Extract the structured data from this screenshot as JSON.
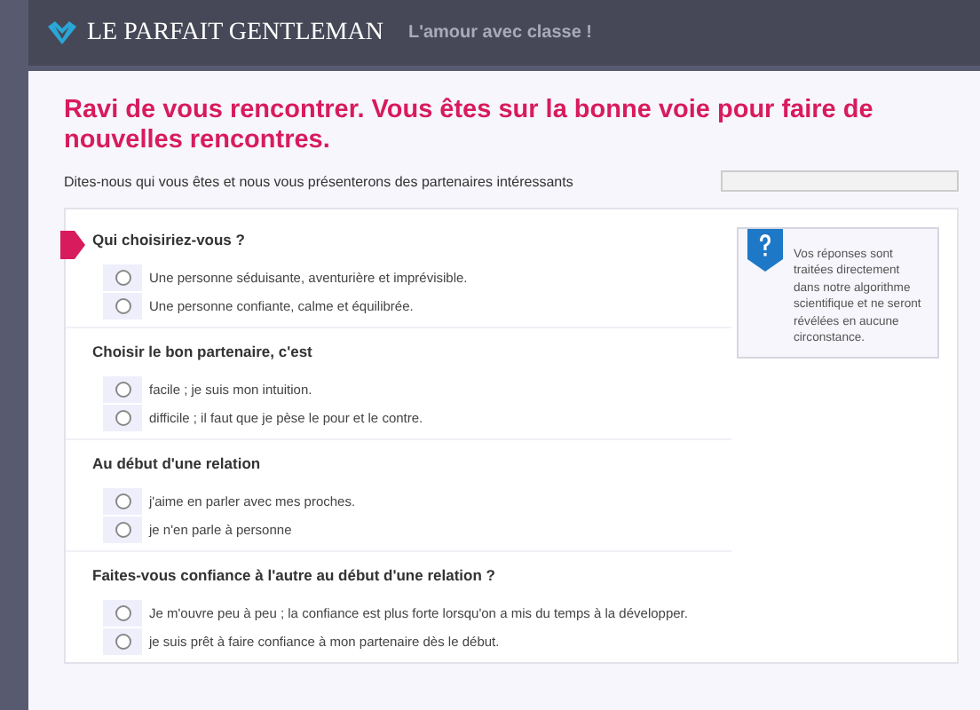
{
  "header": {
    "brand": "LE PARFAIT GENTLEMAN",
    "tagline": "L'amour avec classe !"
  },
  "intro": {
    "title": "Ravi de vous rencontrer. Vous êtes sur la bonne voie pour faire de nouvelles rencontres.",
    "subtitle": "Dites-nous qui vous êtes et nous vous présenterons des partenaires intéressants",
    "progress": {
      "level": 0
    }
  },
  "info": {
    "text": "Vos réponses sont traitées directement dans notre algorithme scientifique et ne seront révélées en aucune circonstance."
  },
  "questions": [
    {
      "title": "Qui choisiriez-vous ?",
      "active": true,
      "options": [
        {
          "label": "Une personne séduisante, aventurière et imprévisible.",
          "selected": false
        },
        {
          "label": "Une personne confiante, calme et équilibrée.",
          "selected": false
        }
      ]
    },
    {
      "title": "Choisir le bon partenaire, c'est",
      "active": false,
      "options": [
        {
          "label": "facile ; je suis mon intuition.",
          "selected": false
        },
        {
          "label": "difficile ; il faut que je pèse le pour et le contre.",
          "selected": false
        }
      ]
    },
    {
      "title": "Au début d'une relation",
      "active": false,
      "options": [
        {
          "label": "j'aime en parler avec mes proches.",
          "selected": false
        },
        {
          "label": "je n'en parle à personne",
          "selected": false
        }
      ]
    },
    {
      "title": "Faites-vous confiance à l'autre au début d'une relation ?",
      "active": false,
      "options": [
        {
          "label": "Je m'ouvre peu à peu ; la confiance est plus forte lorsqu'on a mis du temps à la développer.",
          "selected": false
        },
        {
          "label": "je suis prêt à faire confiance à mon partenaire dès le début.",
          "selected": false
        }
      ]
    }
  ]
}
